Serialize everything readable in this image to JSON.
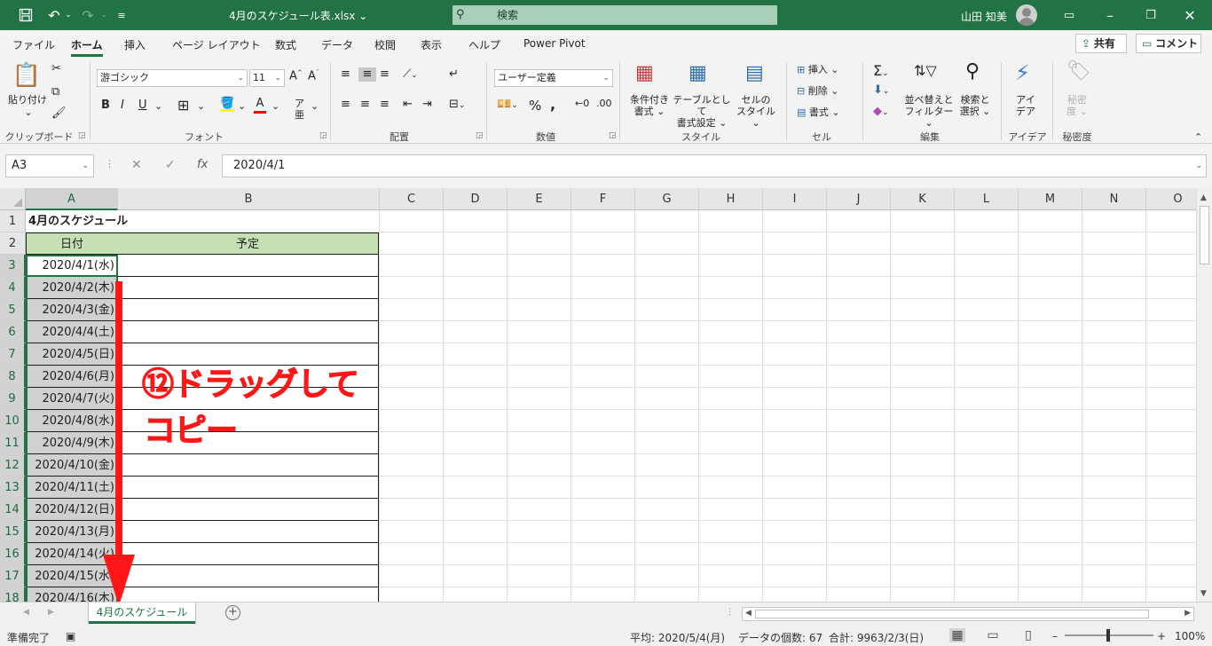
{
  "titlebar": {
    "doc_title": "4月のスケジュール表.xlsx ⌄",
    "search": "検索",
    "user": "山田 知美"
  },
  "tabs": [
    "ファイル",
    "ホーム",
    "挿入",
    "ページ レイアウト",
    "数式",
    "データ",
    "校閲",
    "表示",
    "ヘルプ",
    "Power Pivot"
  ],
  "active_tab": "ホーム",
  "share": "共有",
  "comment": "コメント",
  "ribbon": {
    "clipboard": {
      "label": "クリップボード",
      "paste": "貼り付け"
    },
    "font": {
      "label": "フォント",
      "name": "游ゴシック",
      "size": "11"
    },
    "alignment": {
      "label": "配置"
    },
    "number": {
      "label": "数値",
      "format": "ユーザー定義"
    },
    "styles": {
      "label": "スタイル",
      "cond_fmt_1": "条件付き",
      "cond_fmt_2": "書式",
      "table_1": "テーブルとして",
      "table_2": "書式設定",
      "cell_1": "セルの",
      "cell_2": "スタイル"
    },
    "cells": {
      "label": "セル",
      "insert": "挿入",
      "delete": "削除",
      "format": "書式"
    },
    "editing": {
      "label": "編集",
      "sort_1": "並べ替えと",
      "sort_2": "フィルター",
      "find_1": "検索と",
      "find_2": "選択"
    },
    "ideas": {
      "label": "アイデア",
      "btn_1": "アイ",
      "btn_2": "デア"
    },
    "sensitivity": {
      "label": "秘密度",
      "btn_1": "秘密",
      "btn_2": "度"
    }
  },
  "formula": {
    "namebox": "A3",
    "value": "2020/4/1",
    "fx": "fx"
  },
  "columns": [
    "A",
    "B",
    "C",
    "D",
    "E",
    "F",
    "G",
    "H",
    "I",
    "J",
    "K",
    "L",
    "M",
    "N",
    "O"
  ],
  "rows": [
    "1",
    "2",
    "3",
    "4",
    "5",
    "6",
    "7",
    "8",
    "9",
    "10",
    "11",
    "12",
    "13",
    "14",
    "15",
    "16",
    "17",
    "18"
  ],
  "sheet": {
    "title": "4月のスケジュール",
    "header_date": "日付",
    "header_schedule": "予定",
    "dates": [
      "2020/4/1(水)",
      "2020/4/2(木)",
      "2020/4/3(金)",
      "2020/4/4(土)",
      "2020/4/5(日)",
      "2020/4/6(月)",
      "2020/4/7(火)",
      "2020/4/8(水)",
      "2020/4/9(木)",
      "2020/4/10(金)",
      "2020/4/11(土)",
      "2020/4/12(日)",
      "2020/4/13(月)",
      "2020/4/14(火)",
      "2020/4/15(水)",
      "2020/4/16(木)"
    ]
  },
  "annotation": {
    "line1": "⑫ドラッグして",
    "line2": "コピー",
    "color": "#ff1616"
  },
  "sheet_tab": "4月のスケジュール",
  "status": {
    "ready": "準備完了",
    "average": "平均: 2020/5/4(月)",
    "count": "データの個数: 67",
    "sum": "合計: 9963/2/3(日)",
    "zoom": "100%"
  },
  "colors": {
    "accent": "#217346",
    "header_fill": "#c6e0b4"
  }
}
